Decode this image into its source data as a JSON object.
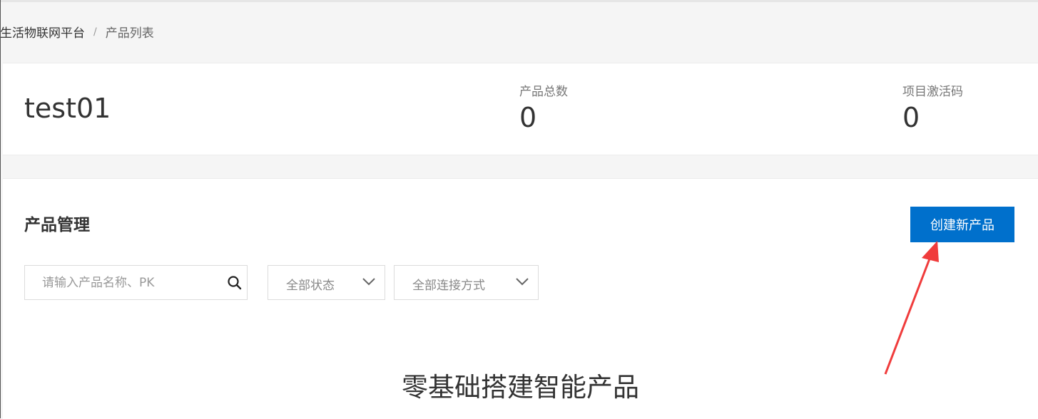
{
  "breadcrumb": {
    "root": "生活物联网平台",
    "separator": "/",
    "current": "产品列表"
  },
  "project": {
    "name": "test01",
    "stats": [
      {
        "label": "产品总数",
        "value": "0"
      },
      {
        "label": "项目激活码",
        "value": "0"
      }
    ]
  },
  "products": {
    "title": "产品管理",
    "create_button": "创建新产品",
    "search": {
      "placeholder": "请输入产品名称、PK",
      "value": "",
      "icon": "search-icon"
    },
    "filters": {
      "status": {
        "selected": "全部状态"
      },
      "connection": {
        "selected": "全部连接方式"
      }
    },
    "empty_state_title": "零基础搭建智能产品"
  },
  "colors": {
    "primary": "#0070cc",
    "annotation_arrow": "#f03c3c"
  }
}
